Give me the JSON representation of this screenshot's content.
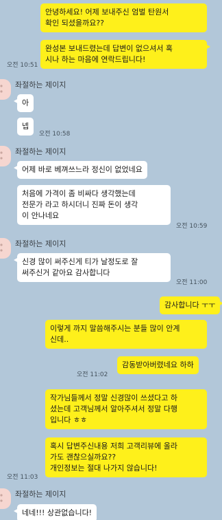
{
  "colors": {
    "background": "#b2c7d9",
    "my_bubble": "#fef01b",
    "their_bubble": "#ffffff"
  },
  "contact_name": "좌절하는 제이지",
  "messages": [
    {
      "id": "m1",
      "from": "me",
      "text": "안녕하세요! 어제 보내주신 엄벌 탄원서\n확인 되셨을까요??"
    },
    {
      "id": "m2",
      "from": "me",
      "text": "완성본 보내드렸는데 답변이 없으셔서 혹\n시나 하는 마음에 연락드립니다!",
      "time": "오전 10:51"
    },
    {
      "id": "m3",
      "from": "them",
      "text": "아"
    },
    {
      "id": "m4",
      "from": "them",
      "text": "넵",
      "time": "오전 10:58"
    },
    {
      "id": "m5",
      "from": "them",
      "text": "어제 바로 베껴쓰느라 정신이 없었네요"
    },
    {
      "id": "m6",
      "from": "them",
      "text": "처음에 가격이 좀 비싸다 생각했는데\n전문가 라고 하시더니 진짜 돈이 생각\n이 안나네요",
      "time": "오전 10:59"
    },
    {
      "id": "m7",
      "from": "them",
      "text": "신경 많이 써주신게 티가 날정도로 잘\n써주신거 같아요 감사합니다",
      "time": "오전 11:00"
    },
    {
      "id": "m8",
      "from": "me",
      "text": "감사합니다 ㅜㅜ"
    },
    {
      "id": "m9",
      "from": "me",
      "text": "이렇게 까지 말씀해주시는 분들 많이 안계\n신데.."
    },
    {
      "id": "m10",
      "from": "me",
      "text": "감동받아버렸네요 하하",
      "time": "오전 11:02"
    },
    {
      "id": "m11",
      "from": "me",
      "text": "작가님들께서 정말 신경많이 쓰셨다고 하\n셨는데 고객님께서 알아주셔서 정말 다행\n입니다 ㅎㅎ"
    },
    {
      "id": "m12",
      "from": "me",
      "text": "혹시 답변주신내용 저희 고객리뷰에 올라\n가도 괜찮으실까요??\n개인정보는 절대 나가지 않습니다!",
      "time": "오전 11:03"
    },
    {
      "id": "m13",
      "from": "them",
      "text": "네네!!! 상관없습니다!"
    }
  ]
}
